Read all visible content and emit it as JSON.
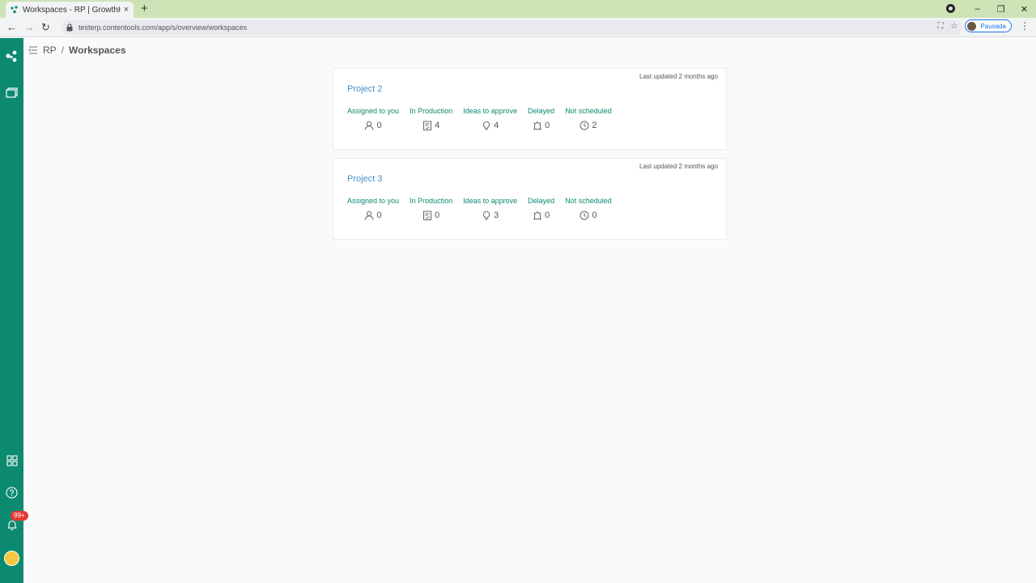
{
  "browser": {
    "tab_title": "Workspaces - RP | GrowthH",
    "tab_close": "×",
    "new_tab": "+",
    "url": "testerp.contentools.com/app/s/overview/workspaces",
    "profile_label": "Pausada",
    "window_controls": [
      "–",
      "❐",
      "✕"
    ],
    "nav": {
      "back": "←",
      "forward": "→",
      "reload": "↻"
    }
  },
  "sidebar": {
    "items": [
      {
        "name": "logo-icon"
      },
      {
        "name": "workspaces-icon"
      },
      {
        "name": "apps-grid-icon"
      },
      {
        "name": "help-icon"
      },
      {
        "name": "notifications-icon"
      }
    ],
    "notification_badge": "99+"
  },
  "breadcrumb": {
    "root": "RP",
    "separator": "/",
    "current": "Workspaces"
  },
  "workspaces": [
    {
      "title": "Project 2",
      "updated": "Last updated 2 months ago",
      "stats": [
        {
          "label": "Assigned to you",
          "value": "0",
          "icon": "user-icon"
        },
        {
          "label": "In Production",
          "value": "4",
          "icon": "document-icon"
        },
        {
          "label": "Ideas to approve",
          "value": "4",
          "icon": "lightbulb-icon"
        },
        {
          "label": "Delayed",
          "value": "0",
          "icon": "alarm-icon"
        },
        {
          "label": "Not scheduled",
          "value": "2",
          "icon": "clock-icon"
        }
      ]
    },
    {
      "title": "Project 3",
      "updated": "Last updated 2 months ago",
      "stats": [
        {
          "label": "Assigned to you",
          "value": "0",
          "icon": "user-icon"
        },
        {
          "label": "In Production",
          "value": "0",
          "icon": "document-icon"
        },
        {
          "label": "Ideas to approve",
          "value": "3",
          "icon": "lightbulb-icon"
        },
        {
          "label": "Delayed",
          "value": "0",
          "icon": "alarm-icon"
        },
        {
          "label": "Not scheduled",
          "value": "0",
          "icon": "clock-icon"
        }
      ]
    }
  ],
  "colors": {
    "sidebar": "#0b8a70",
    "accent_label": "#0b8a70",
    "title_link": "#4a90c2",
    "badge": "#e53935"
  }
}
